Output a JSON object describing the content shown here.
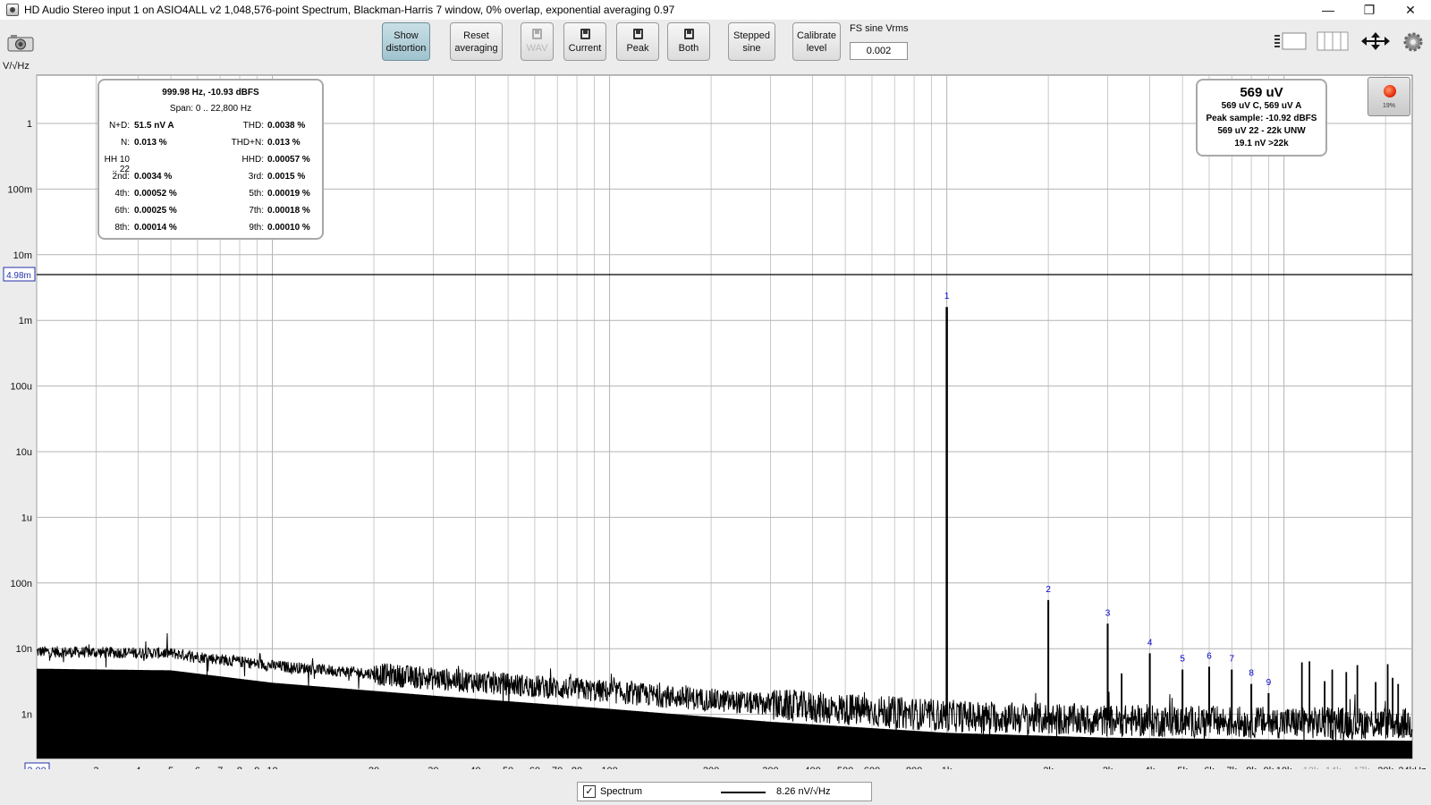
{
  "window": {
    "title": "HD Audio Stereo input 1 on ASIO4ALL v2 1,048,576-point Spectrum, Blackman-Harris 7 window, 0% overlap, exponential averaging 0.97",
    "minimize": "—",
    "restore": "❐",
    "close": "✕"
  },
  "toolbar": {
    "show_distortion": [
      "Show",
      "distortion"
    ],
    "reset_averaging": [
      "Reset",
      "averaging"
    ],
    "wav": "WAV",
    "current": "Current",
    "peak": "Peak",
    "both": "Both",
    "stepped_sine": [
      "Stepped",
      "sine"
    ],
    "calibrate_level": [
      "Calibrate",
      "level"
    ],
    "fs_label": "FS sine Vrms",
    "fs_value": "0.002"
  },
  "y_unit": "V/√Hz",
  "distortion": {
    "header": "999.98 Hz, -10.93 dBFS",
    "span": "Span: 0 .. 22,800 Hz",
    "rows": [
      {
        "l1": "N+D:",
        "v1": "51.5 nV A",
        "l2": "THD:",
        "v2": "0.0038 %"
      },
      {
        "l1": "N:",
        "v1": "0.013 %",
        "l2": "THD+N:",
        "v2": "0.013 %"
      },
      {
        "l1": "HH 10 .. 22",
        "v1": "",
        "l2": "HHD:",
        "v2": "0.00057 %"
      },
      {
        "l1": "2nd:",
        "v1": "0.0034 %",
        "l2": "3rd:",
        "v2": "0.0015 %"
      },
      {
        "l1": "4th:",
        "v1": "0.00052 %",
        "l2": "5th:",
        "v2": "0.00019 %"
      },
      {
        "l1": "6th:",
        "v1": "0.00025 %",
        "l2": "7th:",
        "v2": "0.00018 %"
      },
      {
        "l1": "8th:",
        "v1": "0.00014 %",
        "l2": "9th:",
        "v2": "0.00010 %"
      }
    ]
  },
  "level": {
    "main": "569 uV",
    "lines": [
      "569 uV C, 569 uV A",
      "Peak sample: -10.92 dBFS",
      "569 uV 22 - 22k UNW",
      "19.1 nV >22k"
    ]
  },
  "record_pct": "19%",
  "legend": {
    "checked": "✓",
    "name": "Spectrum",
    "value": "8.26 nV/√Hz"
  },
  "colors": {
    "plot_bg": "#ffffff",
    "grid": "#b4b4b4",
    "trace": "#000000",
    "marker_text": "#0000cc"
  },
  "chart_data": {
    "type": "line",
    "xscale": "log",
    "yscale": "log",
    "xlim": [
      2,
      24000
    ],
    "ylim": [
      5e-10,
      0.008
    ],
    "grid": true,
    "cursor_level": 0.00498,
    "cursor_label": "4.98m",
    "x_start_label": "2.00",
    "yticks": [
      {
        "v": 1,
        "label": "1"
      },
      {
        "v": 0.1,
        "label": "100m"
      },
      {
        "v": 0.01,
        "label": "10m"
      },
      {
        "v": 0.001,
        "label": "1m"
      },
      {
        "v": 0.0001,
        "label": "100u"
      },
      {
        "v": 1e-05,
        "label": "10u"
      },
      {
        "v": 1e-06,
        "label": "1u"
      },
      {
        "v": 1e-07,
        "label": "100n"
      },
      {
        "v": 1e-08,
        "label": "10n"
      },
      {
        "v": 1e-09,
        "label": "1n"
      }
    ],
    "xticks": [
      {
        "v": 3,
        "label": "3"
      },
      {
        "v": 4,
        "label": "4"
      },
      {
        "v": 5,
        "label": "5"
      },
      {
        "v": 6,
        "label": "6"
      },
      {
        "v": 7,
        "label": "7"
      },
      {
        "v": 8,
        "label": "8"
      },
      {
        "v": 9,
        "label": "9"
      },
      {
        "v": 10,
        "label": "10"
      },
      {
        "v": 20,
        "label": "20"
      },
      {
        "v": 30,
        "label": "30"
      },
      {
        "v": 40,
        "label": "40"
      },
      {
        "v": 50,
        "label": "50"
      },
      {
        "v": 60,
        "label": "60"
      },
      {
        "v": 70,
        "label": "70"
      },
      {
        "v": 80,
        "label": "80"
      },
      {
        "v": 100,
        "label": "100"
      },
      {
        "v": 200,
        "label": "200"
      },
      {
        "v": 300,
        "label": "300"
      },
      {
        "v": 400,
        "label": "400"
      },
      {
        "v": 500,
        "label": "500"
      },
      {
        "v": 600,
        "label": "600"
      },
      {
        "v": 800,
        "label": "800"
      },
      {
        "v": 1000,
        "label": "1k"
      },
      {
        "v": 2000,
        "label": "2k"
      },
      {
        "v": 3000,
        "label": "3k"
      },
      {
        "v": 4000,
        "label": "4k"
      },
      {
        "v": 5000,
        "label": "5k"
      },
      {
        "v": 6000,
        "label": "6k"
      },
      {
        "v": 7000,
        "label": "7k"
      },
      {
        "v": 8000,
        "label": "8k"
      },
      {
        "v": 9000,
        "label": "9k"
      },
      {
        "v": 10000,
        "label": "10k"
      },
      {
        "v": 12000,
        "label": "12k",
        "dim": true
      },
      {
        "v": 14000,
        "label": "14k",
        "dim": true
      },
      {
        "v": 17000,
        "label": "17k",
        "dim": true
      },
      {
        "v": 20000,
        "label": "20k"
      },
      {
        "v": 24000,
        "label": "24kHz"
      }
    ],
    "noise_floor": [
      {
        "f": 2,
        "v": 9e-09
      },
      {
        "f": 5,
        "v": 8.5e-09
      },
      {
        "f": 10,
        "v": 5.5e-09
      },
      {
        "f": 30,
        "v": 3.5e-09
      },
      {
        "f": 100,
        "v": 2.2e-09
      },
      {
        "f": 300,
        "v": 1.4e-09
      },
      {
        "f": 1000,
        "v": 9.5e-10
      },
      {
        "f": 3000,
        "v": 8e-10
      },
      {
        "f": 10000,
        "v": 7.5e-10
      },
      {
        "f": 24000,
        "v": 7.2e-10
      }
    ],
    "harmonics": [
      {
        "n": "1",
        "f": 1000,
        "v": 0.0016
      },
      {
        "n": "2",
        "f": 2000,
        "v": 5.5e-08
      },
      {
        "n": "3",
        "f": 3000,
        "v": 2.4e-08
      },
      {
        "n": "4",
        "f": 4000,
        "v": 8.5e-09
      },
      {
        "n": "5",
        "f": 5000,
        "v": 4.8e-09
      },
      {
        "n": "6",
        "f": 6000,
        "v": 5.3e-09
      },
      {
        "n": "7",
        "f": 7000,
        "v": 4.8e-09
      },
      {
        "n": "8",
        "f": 8000,
        "v": 2.9e-09
      },
      {
        "n": "9",
        "f": 9000,
        "v": 2.1e-09
      }
    ],
    "spurs": [
      {
        "f": 3300,
        "v": 4.2e-09
      },
      {
        "f": 11300,
        "v": 6.2e-09
      },
      {
        "f": 11900,
        "v": 6.4e-09
      },
      {
        "f": 13200,
        "v": 3.2e-09
      },
      {
        "f": 13900,
        "v": 4.8e-09
      },
      {
        "f": 15300,
        "v": 4.4e-09
      },
      {
        "f": 16500,
        "v": 5.6e-09
      },
      {
        "f": 18700,
        "v": 3.1e-09
      },
      {
        "f": 20300,
        "v": 5.8e-09
      },
      {
        "f": 21000,
        "v": 3.6e-09
      },
      {
        "f": 21800,
        "v": 2.9e-09
      }
    ]
  }
}
